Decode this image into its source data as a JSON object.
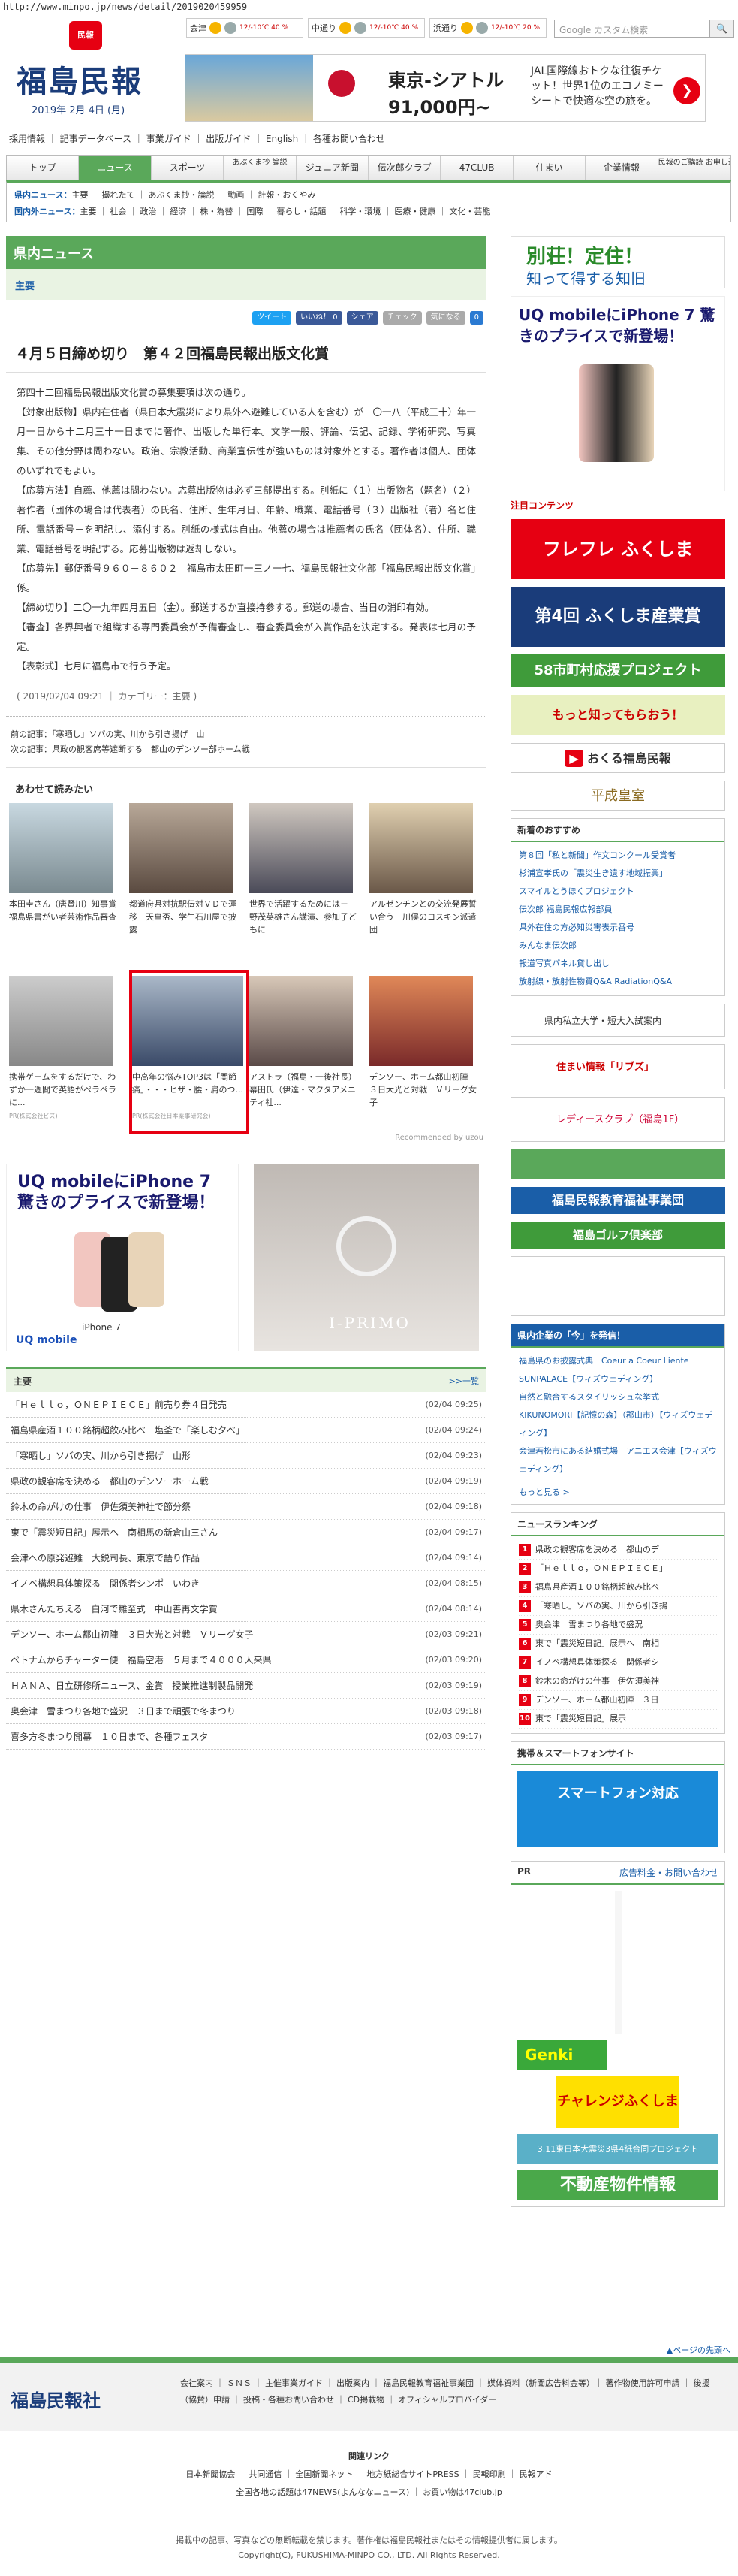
{
  "url": "http://www.minpo.jp/news/detail/2019020459959",
  "header": {
    "logo_emblem": "民報",
    "logo": "福島民報",
    "date": "2019年 2月 4日 (月)",
    "weather": [
      {
        "place": "会津",
        "temp": "12/-10℃ 40 %"
      },
      {
        "place": "中通り",
        "temp": "12/-10℃ 40 %"
      },
      {
        "place": "浜通り",
        "temp": "12/-10℃ 20 %"
      }
    ],
    "search_placeholder": "Google カスタム検索",
    "banner": {
      "line1": "東京-シアトル",
      "line2": "91,000円~",
      "side": "JAL国際線おトクな往復チケット！世界1位のエコノミーシートで快適な空の旅を。"
    }
  },
  "sublinks": "採用情報 ｜ 記事データベース ｜ 事業ガイド ｜ 出版ガイド ｜ English ｜ 各種お問い合わせ",
  "gnav": [
    "トップ",
    "ニュース",
    "スポーツ",
    "あぶくま抄 論説",
    "ジュニア新聞",
    "伝次郎クラブ",
    "47CLUB",
    "住まい",
    "企業情報",
    "民報のご購読 お申し込み"
  ],
  "catnav": {
    "row1_label": "県内ニュース：",
    "row1": "主要 ｜ 撮れたて ｜ あぶくま抄・論説 ｜ 動画 ｜ 計報・おくやみ",
    "row2_label": "国内外ニュース：",
    "row2": "主要 ｜ 社会 ｜ 政治 ｜ 経済 ｜ 株・為替 ｜ 国際 ｜ 暮らし・話題 ｜ 科学・環境 ｜ 医療・健康 ｜ 文化・芸能"
  },
  "section": {
    "title": "県内ニュース",
    "sub": "主要"
  },
  "share": [
    "ツイート",
    "いいね！ 0",
    "シェア",
    "チェック",
    "気になる",
    "0"
  ],
  "article": {
    "title": "４月５日締め切り　第４２回福島民報出版文化賞",
    "paras": [
      "第四十二回福島民報出版文化賞の募集要項は次の通り。",
      "【対象出版物】県内在住者（県日本大震災により県外へ避難している人を含む）が二〇一八（平成三十）年一月一日から十二月三十一日までに著作、出版した単行本。文学一般、評論、伝記、記録、学術研究、写真集、その他分野は問わない。政治、宗教活動、商業宣伝性が強いものは対象外とする。著作者は個人、団体のいずれでもよい。",
      "【応募方法】自薦、他薦は問わない。応募出版物は必ず三部提出する。別紙に（１）出版物名（題名）（２）著作者（団体の場合は代表者）の氏名、住所、生年月日、年齢、職業、電話番号（３）出版社（者）名と住所、電話番号－を明記し、添付する。別紙の様式は自由。他薦の場合は推薦者の氏名（団体名）、住所、職業、電話番号を明記する。応募出版物は返却しない。",
      "【応募先】郵便番号９６０－８６０２　福島市太田町一三ノ一七、福島民報社文化部「福島民報出版文化賞」係。",
      "【締め切り】二〇一九年四月五日（金）。郵送するか直接持参する。郵送の場合、当日の消印有効。",
      "【審査】各界興者で組織する専門委員会が予備審査し、審査委員会が入賞作品を決定する。発表は七月の予定。",
      "【表彰式】七月に福島市で行う予定。"
    ],
    "meta": "( 2019/02/04 09:21 ｜ カテゴリー：主要 )"
  },
  "prevnext": {
    "prev": "前の記事：「寒晒し」ソバの実、川から引き揚げ　山",
    "next": "次の記事：県政の観客席等遮断する　都山のデンソー部ホーム戦"
  },
  "related": {
    "title": "あわせて読みたい",
    "recommended": "Recommended by uzou",
    "tiles": [
      "本田圭さん（唐賢川）知事賞　福島県書がい者芸術作品審査",
      "都道府県対抗駅伝対ＶＤで運移　天皇盃、学生石川屋で披露",
      "世界で活躍するためには－　野茂英雄さん講演、参加子どもに",
      "アルゼンチンとの交流発展誓い合う　川俣のコスキン派遣団",
      "携帯ゲームをするだけで、わずか一週間で英語がペラペラに...",
      "中高年の悩みTOP3は「関節痛」・・・ヒザ・腰・肩のつ...",
      "アストラ（福島・一後社長）幕田氏（伊達・マクタアメニティ社...",
      "デンソー、ホーム都山初陣　３日大光と対戦　Ｖリーグ女子"
    ],
    "pr1": "PR(株式会社ビズ)",
    "pr2": "PR(株式会社日本薬事研究会)"
  },
  "ads": {
    "uq_head": "UQ mobileにiPhone 7 驚きのプライスで新登場！",
    "uq_model": "iPhone 7",
    "uq_logo": "UQ mobile",
    "ring": "I-PRIMO"
  },
  "news": {
    "title": "主要",
    "more": ">>一覧",
    "items": [
      [
        "「Ｈｅｌｌｏ，ＯＮＥＰＩＥＣＥ」前売り券４日発売",
        "(02/04 09:25)"
      ],
      [
        "福島県産酒１００銘柄超飲み比べ　塩釜で「楽しむ夕べ」",
        "(02/04 09:24)"
      ],
      [
        "「寒晒し」ソバの実、川から引き揚げ　山形",
        "(02/04 09:23)"
      ],
      [
        "県政の観客席を決める　都山のデンソーホーム戦",
        "(02/04 09:19)"
      ],
      [
        "鈴木の命がけの仕事　伊佐須美神社で節分祭",
        "(02/04 09:18)"
      ],
      [
        "東で「震災短日記」展示へ　南相馬の新倉由三さん",
        "(02/04 09:17)"
      ],
      [
        "会津への原発避難　大鋭司長、東京で語り作品",
        "(02/04 09:14)"
      ],
      [
        "イノベ構想具体策探る　関係者シンポ　いわき",
        "(02/04 08:15)"
      ],
      [
        "県木さんたちえる　白河で雛至式　中山善再文学賞",
        "(02/04 08:14)"
      ],
      [
        "デンソー、ホーム都山初陣　３日大光と対戦　Ｖリーグ女子",
        "(02/03 09:21)"
      ],
      [
        "ベトナムからチャーター便　福島空港　５月まで４０００人来県",
        "(02/03 09:20)"
      ],
      [
        "ＨＡＮＡ、日立研修所ニュース、金賞　授業推進制製品開発",
        "(02/03 09:19)"
      ],
      [
        "奥会津　雪まつり各地で盛況　３日まで頑張で冬まつり",
        "(02/03 09:18)"
      ],
      [
        "喜多方冬まつり開幕　１０日まで、各種フェスタ",
        "(02/03 09:17)"
      ]
    ]
  },
  "side": {
    "b1": "別荘！定住！",
    "b1b": "知って得する知旧",
    "uq": "UQ mobileにiPhone 7 驚きのプライスで新登場！",
    "contents": "注目コンテンツ",
    "fureai": "フレフレ ふくしま",
    "sangyo": "第4回 ふくしま産業賞",
    "shichoson": "58市町村応援プロジェクト",
    "collect": "もっと知ってもらおう！",
    "youtube": "おくる福島民報",
    "heisei": "平成皇室",
    "newbox": {
      "title": "新着のおすすめ",
      "items": [
        "第８回「私と新聞」作文コンクール受賞者",
        "杉浦宣孝氏の「震災生き遺す地域振興」",
        "スマイルとうほくプロジェクト",
        "伝次郎 福島民報広報部員",
        "県外在住の方必知災害表示番号",
        "みんなま伝次郎",
        "報道写真パネル貸し出し",
        "放射線・放射性物質Q&A RadiationQ&A"
      ]
    },
    "univ": "県内私立大学・短大入試案内",
    "sumai": "住まい情報「リブズ」",
    "lady": "レディースクラブ（福島1F）",
    "kyoiku": "福島民報教育福祉事業団",
    "golf": "福島ゴルフ倶楽部",
    "release": {
      "title": "県内企業の「今」を発信！",
      "items": [
        "福島県のお披露式典　Coeur a Coeur Liente SUNPALACE【ウィズウェディング】",
        "自然と融合するスタイリッシュな挙式　KIKUNOMORI【記憶の森】（郡山市）【ウィズウェディング】",
        "会津若松市にある結婚式場　アニエス会津【ウィズウェディング】"
      ],
      "more": "もっと見る >"
    },
    "ranking": {
      "title": "ニュースランキング",
      "items": [
        "県政の観客席を決める　都山のデ",
        "「Ｈｅｌｌｏ，ＯＮＥＰＩＥＣＥ」",
        "福島県産酒１００銘柄超飲み比べ",
        "「寒晒し」ソバの実、川から引き揚",
        "奥会津　雪まつり各地で盛況",
        "東で「震災短日記」展示へ　南相",
        "イノベ構想具体策探る　関係者シ",
        "鈴木の命がけの仕事　伊佐須美神",
        "デンソー、ホーム都山初陣　３日",
        "東で「震災短日記」展示"
      ]
    },
    "mobile": "携帯＆スマートフォンサイト",
    "smart": "スマートフォン対応",
    "pr": "PR",
    "pr_link": "広告料金・お問い合わせ",
    "genki": "Genki",
    "challenge": "チャレンジふくしま",
    "project": "3.11東日本大震災3県4紙合同プロジェクト",
    "fudosan": "不動産物件情報"
  },
  "footer": {
    "logo": "福島民報社",
    "pagetop": "▲ページの先頭へ",
    "links": "会社案内 ｜ ＳＮＳ ｜ 主催事業ガイド ｜ 出版案内 ｜ 福島民報教育福祉事業団 ｜ 媒体資料（新聞広告料金等）｜ 著作物使用許可申請 ｜ 後援（協賛）申請 ｜ 投稿・各種お問い合わせ ｜ CD掲載物 ｜ オフィシャルプロバイダー"
  },
  "rel2": {
    "title": "関連リンク",
    "l1": "日本新聞協会 ｜ 共同通信 ｜ 全国新聞ネット ｜ 地方紙総合サイトPRESS ｜ 民報印刷 ｜ 民報アド",
    "l2": "全国各地の話題は47NEWS(よんななニュース) ｜ お買い物は47club.jp"
  },
  "copy": {
    "l1": "掲載中の記事、写真などの無断転載を禁じます。著作権は福島民報社またはその情報提供者に属します。",
    "l2": "Copyright(C), FUKUSHIMA-MINPO CO., LTD. All Rights Reserved."
  }
}
